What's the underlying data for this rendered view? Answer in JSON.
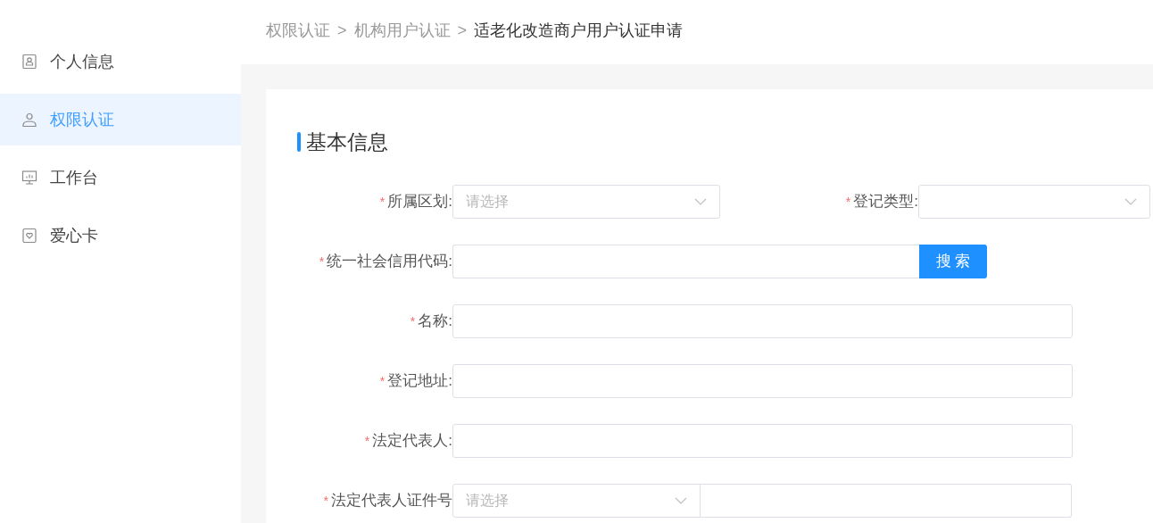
{
  "sidebar": {
    "items": [
      {
        "label": "个人信息",
        "kind": "id",
        "selected": false
      },
      {
        "label": "权限认证",
        "kind": "user",
        "selected": true
      },
      {
        "label": "工作台",
        "kind": "monitor",
        "selected": false
      },
      {
        "label": "爱心卡",
        "kind": "heart",
        "selected": false
      }
    ]
  },
  "breadcrumb": [
    {
      "label": "权限认证",
      "current": false
    },
    {
      "label": "机构用户认证",
      "current": false
    },
    {
      "label": "适老化改造商户用户认证申请",
      "current": true
    }
  ],
  "breadcrumb_separator": ">",
  "section_title": "基本信息",
  "form": {
    "rows": [
      {
        "fields": [
          {
            "label": "所属区划:",
            "required_mark": "*",
            "kind": "select",
            "placeholder": "请选择"
          },
          {
            "label": "登记类型:",
            "required_mark": "*",
            "kind": "select"
          }
        ]
      },
      {
        "fields": [
          {
            "label": "统一社会信用代码:",
            "required_mark": "*",
            "kind": "input_button",
            "button": "搜 索"
          }
        ]
      },
      {
        "fields": [
          {
            "label": "名称:",
            "required_mark": "*",
            "kind": "input"
          }
        ]
      },
      {
        "fields": [
          {
            "label": "登记地址:",
            "required_mark": "*",
            "kind": "input"
          }
        ]
      },
      {
        "fields": [
          {
            "label": "法定代表人:",
            "required_mark": "*",
            "kind": "input"
          }
        ]
      },
      {
        "fields": [
          {
            "label": "法定代表人证件号",
            "required_mark": "*",
            "kind": "select_input",
            "placeholder": "请选择"
          }
        ]
      }
    ]
  }
}
